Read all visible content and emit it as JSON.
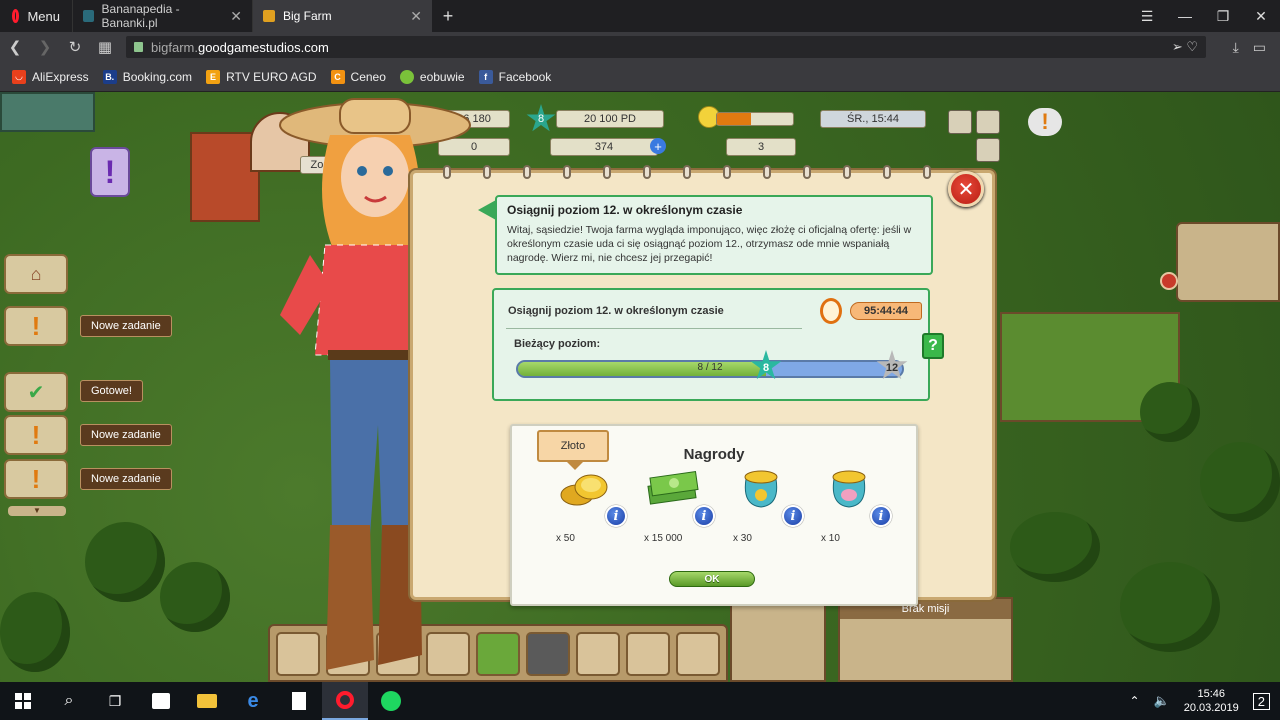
{
  "browser": {
    "menu_label": "Menu",
    "tabs": [
      {
        "title": "Bananapedia - Bananki.pl",
        "active": false,
        "favicon_color": "#2a6a7a"
      },
      {
        "title": "Big Farm",
        "active": true,
        "favicon_color": "#e0a020"
      }
    ],
    "url_prefix": "bigfarm.",
    "url_domain": "goodgamestudios.com",
    "bookmarks": [
      {
        "label": "AliExpress",
        "icon_letter": "",
        "color": "#e8401c"
      },
      {
        "label": "Booking.com",
        "icon_letter": "B.",
        "color": "#1b3d8a"
      },
      {
        "label": "RTV EURO AGD",
        "icon_letter": "E",
        "color": "#f2a212"
      },
      {
        "label": "Ceneo",
        "icon_letter": "C",
        "color": "#f29212"
      },
      {
        "label": "eobuwie",
        "icon_letter": "",
        "color": "#7ac23a"
      },
      {
        "label": "Facebook",
        "icon_letter": "f",
        "color": "#3a5a9a"
      }
    ]
  },
  "hud": {
    "money": "26 180",
    "money2": "0",
    "level": "8",
    "xp": "20 100 PD",
    "gold": "374",
    "happiness": "3",
    "time": "ŚR., 15:44",
    "zone_label": "Zon"
  },
  "side_quests": [
    {
      "tag": "Nowe zadanie"
    },
    {
      "tag": "Gotowe!"
    },
    {
      "tag": "Nowe zadanie"
    },
    {
      "tag": "Nowe zadanie"
    }
  ],
  "dialog": {
    "speech_title": "Osiągnij poziom 12. w określonym czasie",
    "speech_text": "Witaj, sąsiedzie! Twoja farma wygląda imponująco, więc złożę ci oficjalną ofertę: jeśli w określonym czasie uda ci się osiągnąć poziom 12., otrzymasz ode mnie wspaniałą nagrodę. Wierz mi, nie chcesz jej przegapić!",
    "task_title": "Osiągnij poziom 12. w określonym czasie",
    "timer": "95:44:44",
    "current_level_label": "Bieżący poziom:",
    "progress_text": "8 / 12",
    "progress_fraction": 0.645,
    "current_level": "8",
    "target_level": "12",
    "help_label": "?",
    "rewards_title": "Nagrody",
    "tooltip": "Złoto",
    "rewards": [
      {
        "name": "gold-coins",
        "qty": "x 50"
      },
      {
        "name": "cash-stack",
        "qty": "x 15 000"
      },
      {
        "name": "gold-sack",
        "qty": "x 30"
      },
      {
        "name": "piggy-sack",
        "qty": "x 10"
      }
    ],
    "ok_label": "OK",
    "close_label": "✕"
  },
  "bottom": {
    "mission_label": "Brak misji"
  },
  "taskbar": {
    "time": "15:46",
    "date": "20.03.2019",
    "notifications": "2"
  }
}
